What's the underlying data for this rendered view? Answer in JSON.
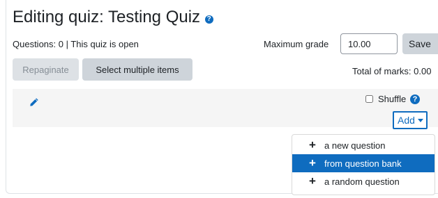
{
  "header": {
    "title": "Editing quiz: Testing Quiz",
    "help_icon": "question-circle-icon"
  },
  "status": {
    "text": "Questions: 0 | This quiz is open"
  },
  "grade": {
    "label": "Maximum grade",
    "value": "10.00",
    "save_label": "Save"
  },
  "toolbar": {
    "repaginate_label": "Repaginate",
    "select_multiple_label": "Select multiple items",
    "total_marks": "Total of marks: 0.00"
  },
  "section": {
    "edit_icon": "pencil-icon",
    "shuffle_label": "Shuffle",
    "shuffle_checked": false,
    "add_label": "Add"
  },
  "add_menu": {
    "items": [
      {
        "label": "a new question",
        "icon": "plus-icon",
        "active": false
      },
      {
        "label": "from question bank",
        "icon": "plus-icon",
        "active": true
      },
      {
        "label": "a random question",
        "icon": "plus-icon",
        "active": false
      }
    ]
  },
  "colors": {
    "accent": "#0f6cbf",
    "button_gray": "#ced4da",
    "section_bg": "#f5f5f5"
  }
}
